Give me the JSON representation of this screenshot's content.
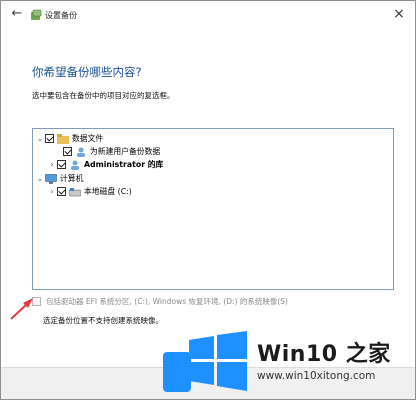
{
  "window": {
    "title": "设置备份"
  },
  "page": {
    "heading": "你希望备份哪些内容?",
    "instruction": "选中要包含在备份中的项目对应的复选框。"
  },
  "tree": {
    "items": [
      {
        "label": "数据文件",
        "expanded": true,
        "checkbox": "checked",
        "icon": "libraries-icon"
      },
      {
        "label": "为新建用户备份数据",
        "checkbox": "checked",
        "icon": "user-icon"
      },
      {
        "label": "Administrator 的库",
        "expanded": false,
        "checkbox": "checked",
        "icon": "user-icon"
      },
      {
        "label": "计算机",
        "expanded": true,
        "checkbox": "none",
        "icon": "computer-icon"
      },
      {
        "label": "本地磁盘 (C:)",
        "expanded": false,
        "checkbox": "checked",
        "icon": "drive-icon"
      }
    ]
  },
  "system_image": {
    "label": "包括驱动器 EFI 系统分区, (C:), Windows 恢复环境, (D:) 的系统映像(S)",
    "checked": false,
    "enabled": false
  },
  "note": "选定备份位置不支持创建系统映像。",
  "watermark": {
    "brand": "Win10 之家",
    "url": "www.win10xitong.com"
  },
  "colors": {
    "heading": "#1a5296",
    "arrow": "#e8383d",
    "watermark_blue": "#1e90ff"
  }
}
